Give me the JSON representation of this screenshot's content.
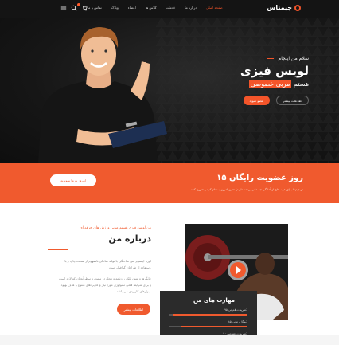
{
  "header": {
    "logo_text": "جیمناس",
    "nav": [
      "صفحه اصلی",
      "درباره ما",
      "خدمات",
      "کلاس ها",
      "اعضاء",
      "وبلاگ",
      "تماس با ما"
    ],
    "active_nav_index": 0,
    "icons": [
      "menu-icon",
      "cart-icon",
      "search-icon"
    ]
  },
  "hero": {
    "hello": "سلام من اینجام",
    "name": "لویس فیزی",
    "role_highlight": "مربی خصوصی",
    "role_suffix": "هستم",
    "primary_btn": "اطلاعات بیشتر",
    "secondary_btn": "عضو شوید"
  },
  "band": {
    "title": "۱۵ روز عضویت رایگان",
    "description": "در جیم‌ما برای هر سطح از آمادگی جسمانی برنامه داریم؛ همین امروز ثبت‌نام کنید و شروع کنید",
    "button": "امروز به ما بپیوندید"
  },
  "about": {
    "subtitle": "من لویس فیزی هستم مربی ورزش های حرفه ای",
    "title": "درباره من",
    "paragraph_1": "لورم ایپسوم متن ساختگی با تولید سادگی نامفهوم از صنعت چاپ و با",
    "paragraph_2": "استفاده از طراحان گرافیک است.",
    "paragraph_3": "چاپگرها و متون بلکه روزنامه و مجله در ستون و سطرآنچنان که لازم است",
    "paragraph_4": "و برای شرایط فعلی تکنولوژی مورد نیاز و کاربردهای متنوع با هدف بهبود",
    "paragraph_5": "ابزارهای کاربردی می باشد.",
    "button": "اطلاعات بیشتر"
  },
  "skills": {
    "title": "مهارت های من",
    "items": [
      {
        "label": "تمرینات قدرتی ۹۵٪",
        "percent": 95
      },
      {
        "label": "یوگا درمانی ۸۵٪",
        "percent": 85
      },
      {
        "label": "تمرینات عمومی ۹۰٪",
        "percent": 90
      }
    ]
  },
  "colors": {
    "accent": "#f05a2e",
    "header_bg": "#141414",
    "skills_bg": "#2b2b2b"
  }
}
